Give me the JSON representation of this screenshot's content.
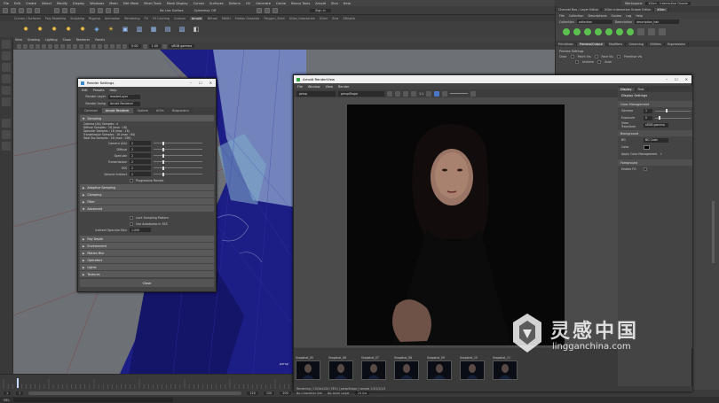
{
  "main_menu": [
    "File",
    "Edit",
    "Create",
    "Select",
    "Modify",
    "Display",
    "Windows",
    "Mesh",
    "Edit Mesh",
    "Mesh Tools",
    "Mesh Display",
    "Curves",
    "Surfaces",
    "Deform",
    "UV",
    "Generate",
    "Cache",
    "Bonus Tools",
    "Arnold",
    "Ziva",
    "Help"
  ],
  "workspace": {
    "label": "Workspace:",
    "value": "XGen - Interactive Groom"
  },
  "status": {
    "surface": "No Live Surface",
    "symmetry": "Symmetry: Off",
    "signin": "Sign In"
  },
  "shelf_tabs": [
    "Curves / Surfaces",
    "Poly Modeling",
    "Sculpting",
    "Rigging",
    "Animation",
    "Rendering",
    "FX",
    "FX Caching",
    "Custom",
    "Arnold",
    "Bifrost",
    "MASH",
    "Motion Graphics",
    "Polygon_Shell",
    "XGen_Interactive",
    "XGen",
    "Ziva",
    "ZBrightr"
  ],
  "shelf_active": "Arnold",
  "viewport": {
    "menu": [
      "View",
      "Shading",
      "Lighting",
      "Show",
      "Renderer",
      "Panels"
    ],
    "field1": "0.00",
    "field2": "1.00",
    "colorspace": "sRGB gamma",
    "persp": "persp"
  },
  "render_settings": {
    "title": "Render Settings",
    "menu": [
      "Edit",
      "Presets",
      "Help"
    ],
    "layer_label": "Render Layer",
    "layer_value": "masterLayer",
    "using_label": "Render Using",
    "using_value": "Arnold Renderer",
    "tabs": [
      "Common",
      "Arnold Renderer",
      "System",
      "AOVs",
      "Diagnostics"
    ],
    "active_tab": "Arnold Renderer",
    "sampling_header": "Sampling",
    "sample_info": [
      "Camera (AA) Samples : 4",
      "Diffuse Samples : 16 (max : 16)",
      "Specular Samples : 16 (max : 16)",
      "Transmission Samples : 16 (max : 64)",
      "Total Sss Samples : 16 (max : 256)"
    ],
    "sampling": [
      {
        "label": "Camera (AA)",
        "value": "2",
        "knob": 0.18
      },
      {
        "label": "Diffuse",
        "value": "2",
        "knob": 0.18
      },
      {
        "label": "Specular",
        "value": "2",
        "knob": 0.18
      },
      {
        "label": "Transmission",
        "value": "2",
        "knob": 0.18
      },
      {
        "label": "SSS",
        "value": "2",
        "knob": 0.18
      },
      {
        "label": "Volume Indirect",
        "value": "2",
        "knob": 0.18
      }
    ],
    "progressive": "Progressive Render",
    "sections": [
      "Adaptive Sampling",
      "Clamping",
      "Filter",
      "Advanced"
    ],
    "advanced_checks": [
      "Lock Sampling Pattern",
      "Use Autobump in SSS"
    ],
    "indirect_label": "Indirect Specular Blur",
    "indirect_value": "1.000",
    "bottom_sections": [
      "Ray Depth",
      "Environment",
      "Motion Blur",
      "Operators",
      "Lights",
      "Textures"
    ],
    "close": "Close"
  },
  "renderview": {
    "title": "Arnold RenderView",
    "menu": [
      "File",
      "Window",
      "View",
      "Render"
    ],
    "camera": "persp",
    "aov": "perspShape",
    "ratio": "1:1",
    "status": "Rendering | 1024x1024 (78%) | perspShape | sample 1/3/2/2/2/2",
    "snapshots": [
      "Snapshot_05",
      "Snapshot_06",
      "Snapshot_07",
      "Snapshot_08",
      "Snapshot_09",
      "Snapshot_10",
      "Snapshot_11"
    ],
    "display": {
      "tabs": [
        "Display",
        "Post"
      ],
      "header": "Display Settings",
      "color_mgmt": "Color Management",
      "gamma_label": "Gamma",
      "gamma_value": "1",
      "exposure_label": "Exposure",
      "exposure_value": "0",
      "view_transform_label": "View Transform",
      "view_transform_value": "sRGB gamma",
      "background": "Background",
      "bg_label": "BG",
      "bg_value": "BG Color",
      "color_label": "Color",
      "apply_cm": "Apply Color Management",
      "foreground": "Foreground",
      "enable_fg": "Enable FG"
    }
  },
  "right_panel": {
    "tabs": [
      "Channel Box / Layer Editor",
      "XGen Interactive Groom Editor",
      "XGen"
    ],
    "menu": [
      "File",
      "Collection",
      "Descriptions",
      "Guides",
      "Log",
      "Help"
    ],
    "collection_label": "Collection",
    "collection_value": "collection",
    "description_label": "Description",
    "description_value": "description_hair",
    "subtabs": [
      "Primitives",
      "Preview/Output",
      "Modifiers",
      "Grooming",
      "Utilities",
      "Expressions"
    ],
    "subtab_active": "Preview/Output",
    "preview": [
      "Preview Settings",
      "Clear",
      "Patch Vis",
      "Face Vis",
      "Primitive Vis",
      "Uniform",
      "Auto"
    ],
    "notes": "Notes: perspShape"
  },
  "timeline": {
    "start": "1",
    "end": "120",
    "range_start": "1",
    "range_end": "120",
    "max": "200",
    "no_char": "No Character Set",
    "no_anim": "No Anim Layer",
    "fps": "24 fps"
  },
  "cmdline": {
    "label": "MEL"
  },
  "watermark": {
    "cn": "灵感中国",
    "en": "lingganchina.com"
  }
}
